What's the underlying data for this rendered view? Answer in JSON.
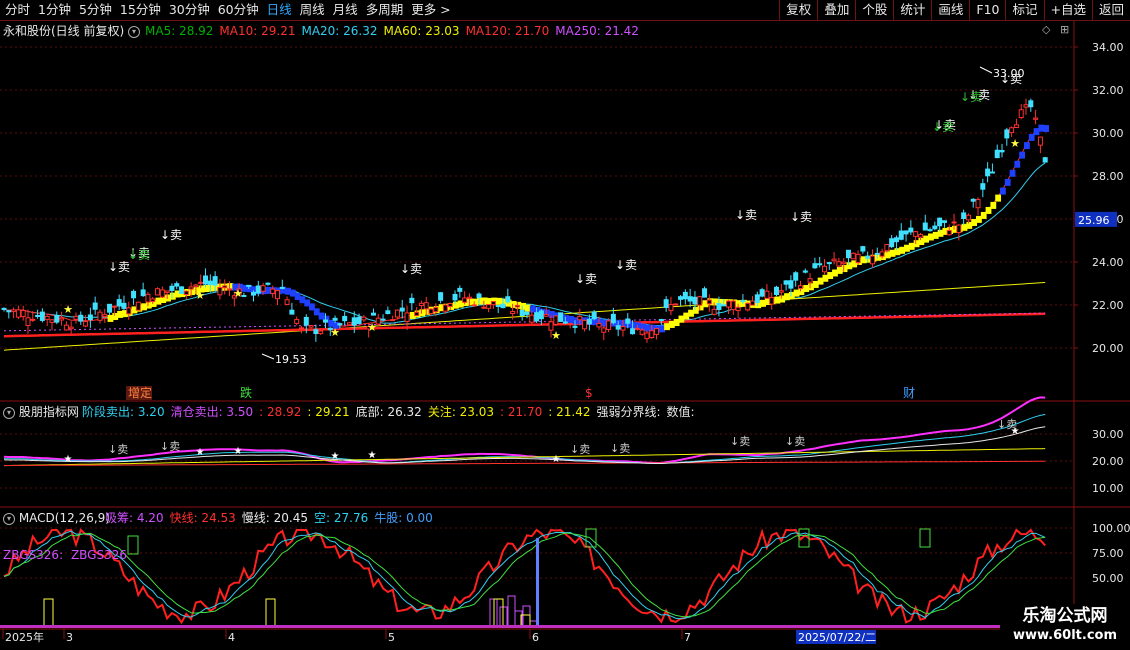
{
  "toolbar": {
    "left": [
      {
        "label": "分时",
        "active": false
      },
      {
        "label": "1分钟",
        "active": false
      },
      {
        "label": "5分钟",
        "active": false
      },
      {
        "label": "15分钟",
        "active": false
      },
      {
        "label": "30分钟",
        "active": false
      },
      {
        "label": "60分钟",
        "active": false
      },
      {
        "label": "日线",
        "active": true
      },
      {
        "label": "周线",
        "active": false
      },
      {
        "label": "月线",
        "active": false
      },
      {
        "label": "多周期",
        "active": false
      },
      {
        "label": "更多 >",
        "active": false
      }
    ],
    "right": [
      "复权",
      "叠加",
      "个股",
      "统计",
      "画线",
      "F10",
      "标记",
      "+自选",
      "返回"
    ]
  },
  "main": {
    "title": "永和股份(日线 前复权)",
    "title_icon": "chevron-down-icon",
    "ma_labels": [
      {
        "text": "MA5: 28.92",
        "color": "#00b000"
      },
      {
        "text": "MA10: 29.21",
        "color": "#ff3030"
      },
      {
        "text": "MA20: 26.32",
        "color": "#30d0f0"
      },
      {
        "text": "MA60: 23.03",
        "color": "#f0f000"
      },
      {
        "text": "MA120: 21.70",
        "color": "#ff3030"
      },
      {
        "text": "MA250: 21.42",
        "color": "#d050ff"
      }
    ],
    "y_ticks": [
      "34.00",
      "32.00",
      "30.00",
      "28.00",
      "26.00",
      "24.00",
      "22.00",
      "20.00"
    ],
    "price_tag": "25.96",
    "high_label": "33.00",
    "low_label": "19.53",
    "sell_mark": "↓卖",
    "events": [
      {
        "text": "增定",
        "color": "#ff8040",
        "bg": "#5a1a10"
      },
      {
        "text": "跌",
        "color": "#40e040",
        "bg": ""
      },
      {
        "text": "$",
        "color": "#ff3030",
        "bg": ""
      },
      {
        "text": "财",
        "color": "#40a0ff",
        "bg": ""
      }
    ]
  },
  "indicator": {
    "title": "股朋指标网",
    "labels": [
      {
        "text": "阶段卖出: 3.20",
        "color": "#30d0f0"
      },
      {
        "text": "清仓卖出: 3.50",
        "color": "#d050ff"
      },
      {
        "text": ": 28.92",
        "color": "#ff3030"
      },
      {
        "text": ": 29.21",
        "color": "#f0f000"
      },
      {
        "text": "底部: 26.32",
        "color": "#e8e8e8"
      },
      {
        "text": "关注: 23.03",
        "color": "#f0f000"
      },
      {
        "text": ": 21.70",
        "color": "#ff3030"
      },
      {
        "text": ": 21.42",
        "color": "#f0f000"
      },
      {
        "text": "强弱分界线:",
        "color": "#e8e8e8"
      },
      {
        "text": "数值:",
        "color": "#e8e8e8"
      }
    ],
    "y_ticks": [
      "30.00",
      "20.00",
      "10.00"
    ]
  },
  "macd": {
    "title": "MACD(12,26,9)",
    "labels": [
      {
        "text": "吸筹: 4.20",
        "color": "#d050ff"
      },
      {
        "text": "快线: 24.53",
        "color": "#ff3030"
      },
      {
        "text": "慢线: 20.45",
        "color": "#e8e8e8"
      },
      {
        "text": "空: 27.76",
        "color": "#30d0f0"
      },
      {
        "text": "牛股: 0.00",
        "color": "#40a0ff"
      }
    ],
    "overlay_label": "ZBGS326:",
    "overlay_label2": "ZBGS326",
    "y_ticks": [
      "100.00",
      "75.00",
      "50.00"
    ]
  },
  "x_axis": {
    "labels": [
      "2025年",
      "3",
      "4",
      "5",
      "6",
      "7"
    ],
    "cursor_date": "2025/07/22/二"
  },
  "watermark": {
    "line1": "乐淘公式网",
    "line2": "www.60lt.com"
  }
}
